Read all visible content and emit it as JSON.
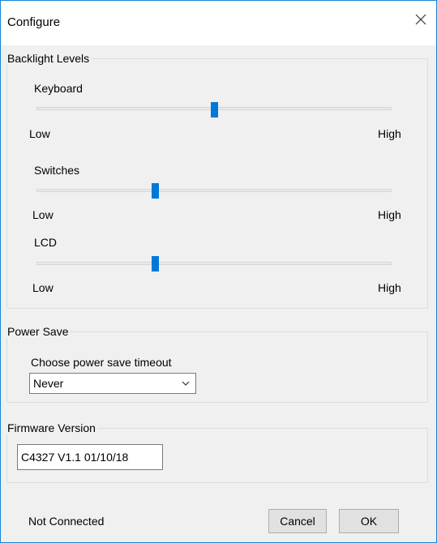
{
  "window": {
    "title": "Configure"
  },
  "backlight": {
    "label": "Backlight Levels",
    "sliders": [
      {
        "label": "Keyboard",
        "low": "Low",
        "high": "High",
        "value": 0.5
      },
      {
        "label": "Switches",
        "low": "Low",
        "high": "High",
        "value": 0.335
      },
      {
        "label": "LCD",
        "low": "Low",
        "high": "High",
        "value": 0.335
      }
    ]
  },
  "power_save": {
    "label": "Power Save",
    "prompt": "Choose power save timeout",
    "selected": "Never"
  },
  "firmware": {
    "label": "Firmware Version",
    "value": "C4327 V1.1 01/10/18"
  },
  "status": "Not Connected",
  "buttons": {
    "cancel": "Cancel",
    "ok": "OK"
  },
  "colors": {
    "accent": "#0078d7",
    "border": "#1883d7"
  },
  "icons": {
    "close": "close-icon",
    "dropdown": "chevron-down-icon"
  }
}
